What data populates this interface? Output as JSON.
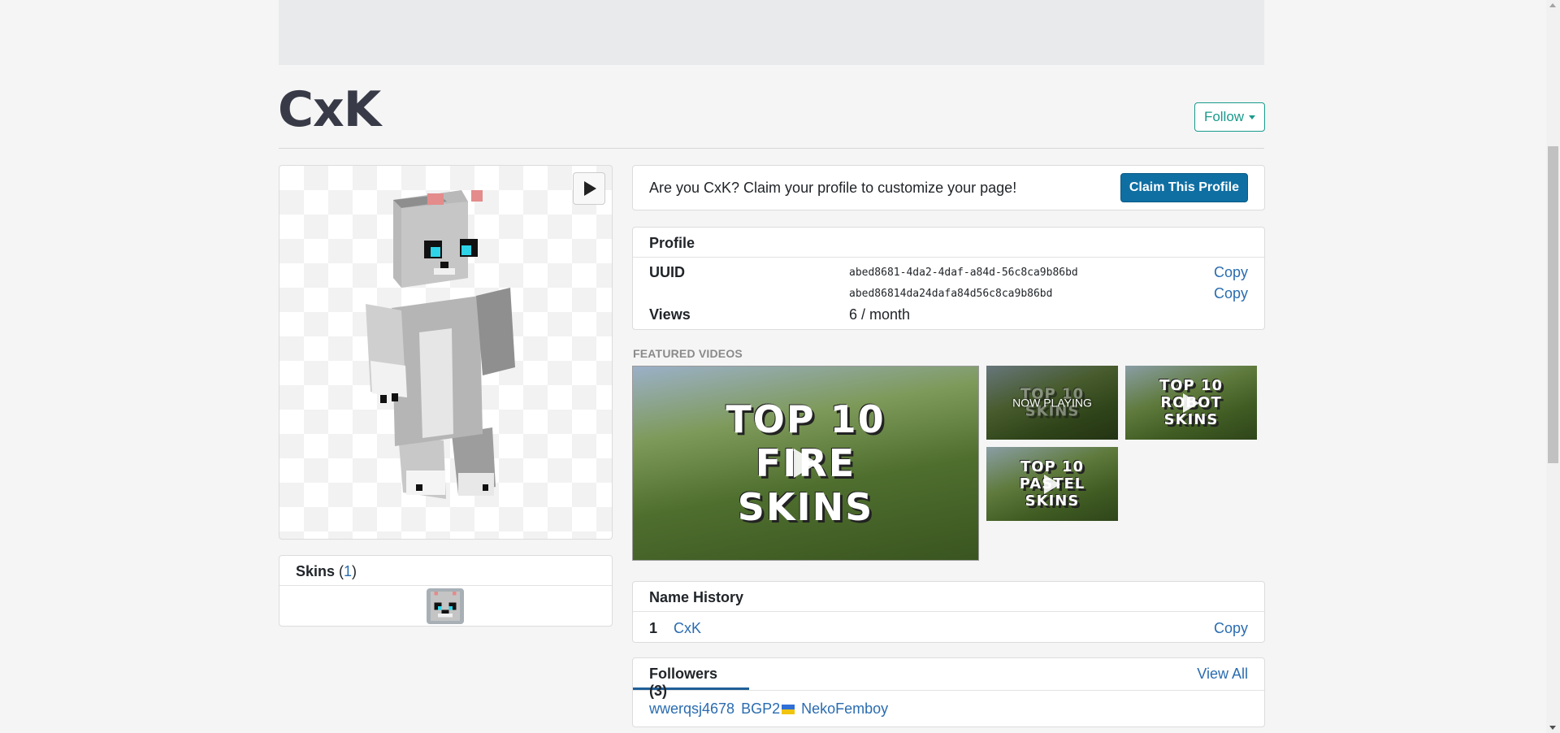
{
  "profile_name": "CxK",
  "follow_button": "Follow",
  "claim": {
    "text": "Are you CxK? Claim your profile to customize your page!",
    "button": "Claim This Profile"
  },
  "profile": {
    "heading": "Profile",
    "uuid_label": "UUID",
    "uuid_dashed": "abed8681-4da2-4daf-a84d-56c8ca9b86bd",
    "uuid_plain": "abed86814da24dafa84d56c8ca9b86bd",
    "copy_label": "Copy",
    "views_label": "Views",
    "views_value": "6 / month"
  },
  "skins": {
    "label": "Skins",
    "count": "1"
  },
  "featured_videos": {
    "label": "FEATURED VIDEOS",
    "main": {
      "line1": "TOP 10",
      "line2": "FIRE",
      "line3": "SKINS"
    },
    "thumbs": [
      {
        "line1": "TOP 10",
        "line2": "",
        "line3": "SKINS",
        "overlay": "NOW PLAYING"
      },
      {
        "line1": "TOP 10",
        "line2": "ROBOT",
        "line3": "SKINS"
      },
      {
        "line1": "TOP 10",
        "line2": "PASTEL",
        "line3": "SKINS"
      }
    ]
  },
  "name_history": {
    "heading": "Name History",
    "entries": [
      {
        "num": "1",
        "name": "CxK",
        "copy": "Copy"
      }
    ]
  },
  "followers": {
    "heading": "Followers (3)",
    "view_all": "View All",
    "names": [
      "wwerqsj4678",
      "BGP2",
      "NekoFemboy"
    ]
  },
  "colors": {
    "accent_teal": "#1a9a8c",
    "claim_button": "#0f6fa3",
    "link": "#2a6cb0"
  }
}
